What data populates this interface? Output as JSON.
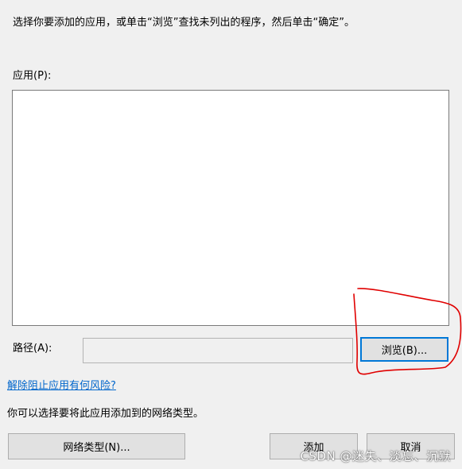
{
  "instruction": "选择你要添加的应用，或单击“浏览”查找未列出的程序，然后单击“确定”。",
  "apps_label": "应用(P):",
  "apps_list": [],
  "path": {
    "label": "路径(A):",
    "value": ""
  },
  "buttons": {
    "browse": "浏览(B)...",
    "network_types": "网络类型(N)...",
    "add": "添加",
    "cancel": "取消"
  },
  "risk_link": "解除阻止应用有何风险?",
  "network_text": "你可以选择要将此应用添加到的网络类型。",
  "watermark": "CSDN @迷失、淡忘、沉默",
  "colors": {
    "link": "#0066cc",
    "annotation": "#e00000",
    "focus_border": "#0078d7"
  }
}
